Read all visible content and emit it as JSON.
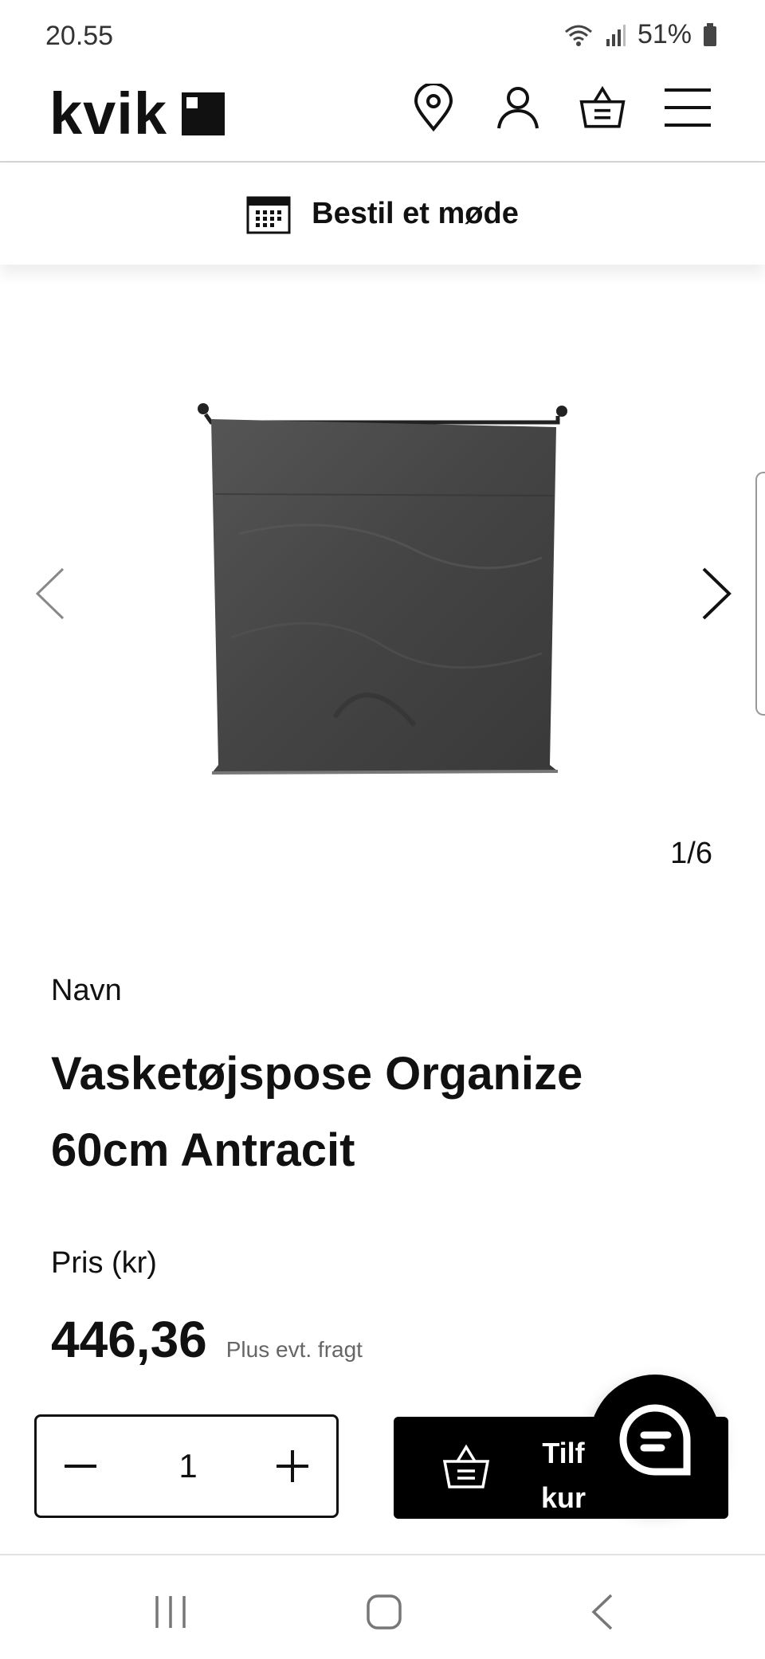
{
  "status": {
    "time": "20.55",
    "battery": "51%"
  },
  "header": {
    "logo": "kvik",
    "icons": [
      "location-pin-icon",
      "user-icon",
      "basket-icon",
      "hamburger-menu-icon"
    ]
  },
  "meeting": {
    "label": "Bestil et møde",
    "icon": "calendar-icon"
  },
  "gallery": {
    "counter": "1/6"
  },
  "product": {
    "name_label": "Navn",
    "title": "Vasketøjspose Organize 60cm Antracit",
    "price_label": "Pris (kr)",
    "price": "446,36",
    "price_note": "Plus evt. fragt"
  },
  "quantity": {
    "value": "1",
    "minus": "−",
    "plus": "+"
  },
  "add_to_cart": {
    "label": "Tilf kur"
  },
  "colors": {
    "black": "#000000",
    "text": "#111111",
    "muted": "#666666",
    "product": "#4a4a4a"
  }
}
